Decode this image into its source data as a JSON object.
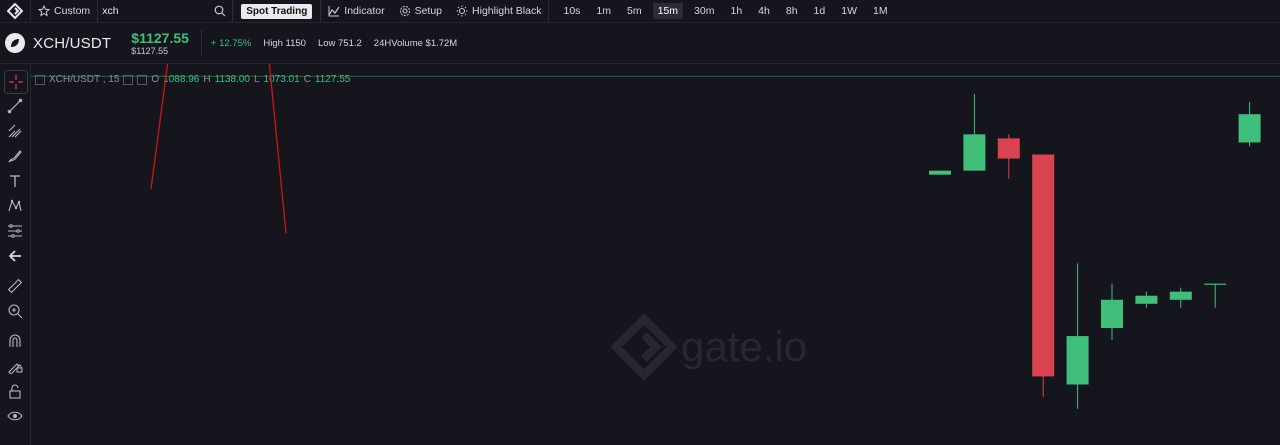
{
  "toolbar": {
    "custom_label": "Custom",
    "search_value": "xch",
    "spot_trading_label": "Spot Trading",
    "indicator_label": "Indicator",
    "setup_label": "Setup",
    "highlight_label": "Highlight Black",
    "intervals": [
      "10s",
      "1m",
      "5m",
      "15m",
      "30m",
      "1h",
      "4h",
      "8h",
      "1d",
      "1W",
      "1M"
    ],
    "active_interval": "15m"
  },
  "ticker": {
    "pair": "XCH/USDT",
    "price": "$1127.55",
    "price_sub": "$1127.55",
    "change": "+ 12.75%",
    "high": "High 1150",
    "low": "Low 751.2",
    "volume": "24HVolume $1.72M"
  },
  "chart": {
    "symbol_label": "XCH/USDT , 15",
    "o_label": "O",
    "o_value": "1088.96",
    "h_label": "H",
    "h_value": "1138.00",
    "l_label": "L",
    "l_value": "1073.01",
    "c_label": "C",
    "c_value": "1127.55",
    "watermark": "gate.io",
    "up_color": "#3fbf7a",
    "down_color": "#d9434f",
    "candles": [
      {
        "o": 1130,
        "h": 1130,
        "l": 1130,
        "c": 1131
      },
      {
        "o": 1131,
        "h": 1150,
        "l": 1131,
        "c": 1140
      },
      {
        "o": 1139,
        "h": 1140,
        "l": 1129,
        "c": 1134
      },
      {
        "o": 1135,
        "h": 1135,
        "l": 1075,
        "c": 1080
      },
      {
        "o": 1078,
        "h": 1108,
        "l": 1072,
        "c": 1090
      },
      {
        "o": 1092,
        "h": 1103,
        "l": 1089,
        "c": 1099
      },
      {
        "o": 1098,
        "h": 1101,
        "l": 1097,
        "c": 1100
      },
      {
        "o": 1099,
        "h": 1102,
        "l": 1097,
        "c": 1101
      },
      {
        "o": 1103,
        "h": 1103,
        "l": 1097,
        "c": 1103
      },
      {
        "o": 1138,
        "h": 1148,
        "l": 1137,
        "c": 1145
      }
    ]
  }
}
